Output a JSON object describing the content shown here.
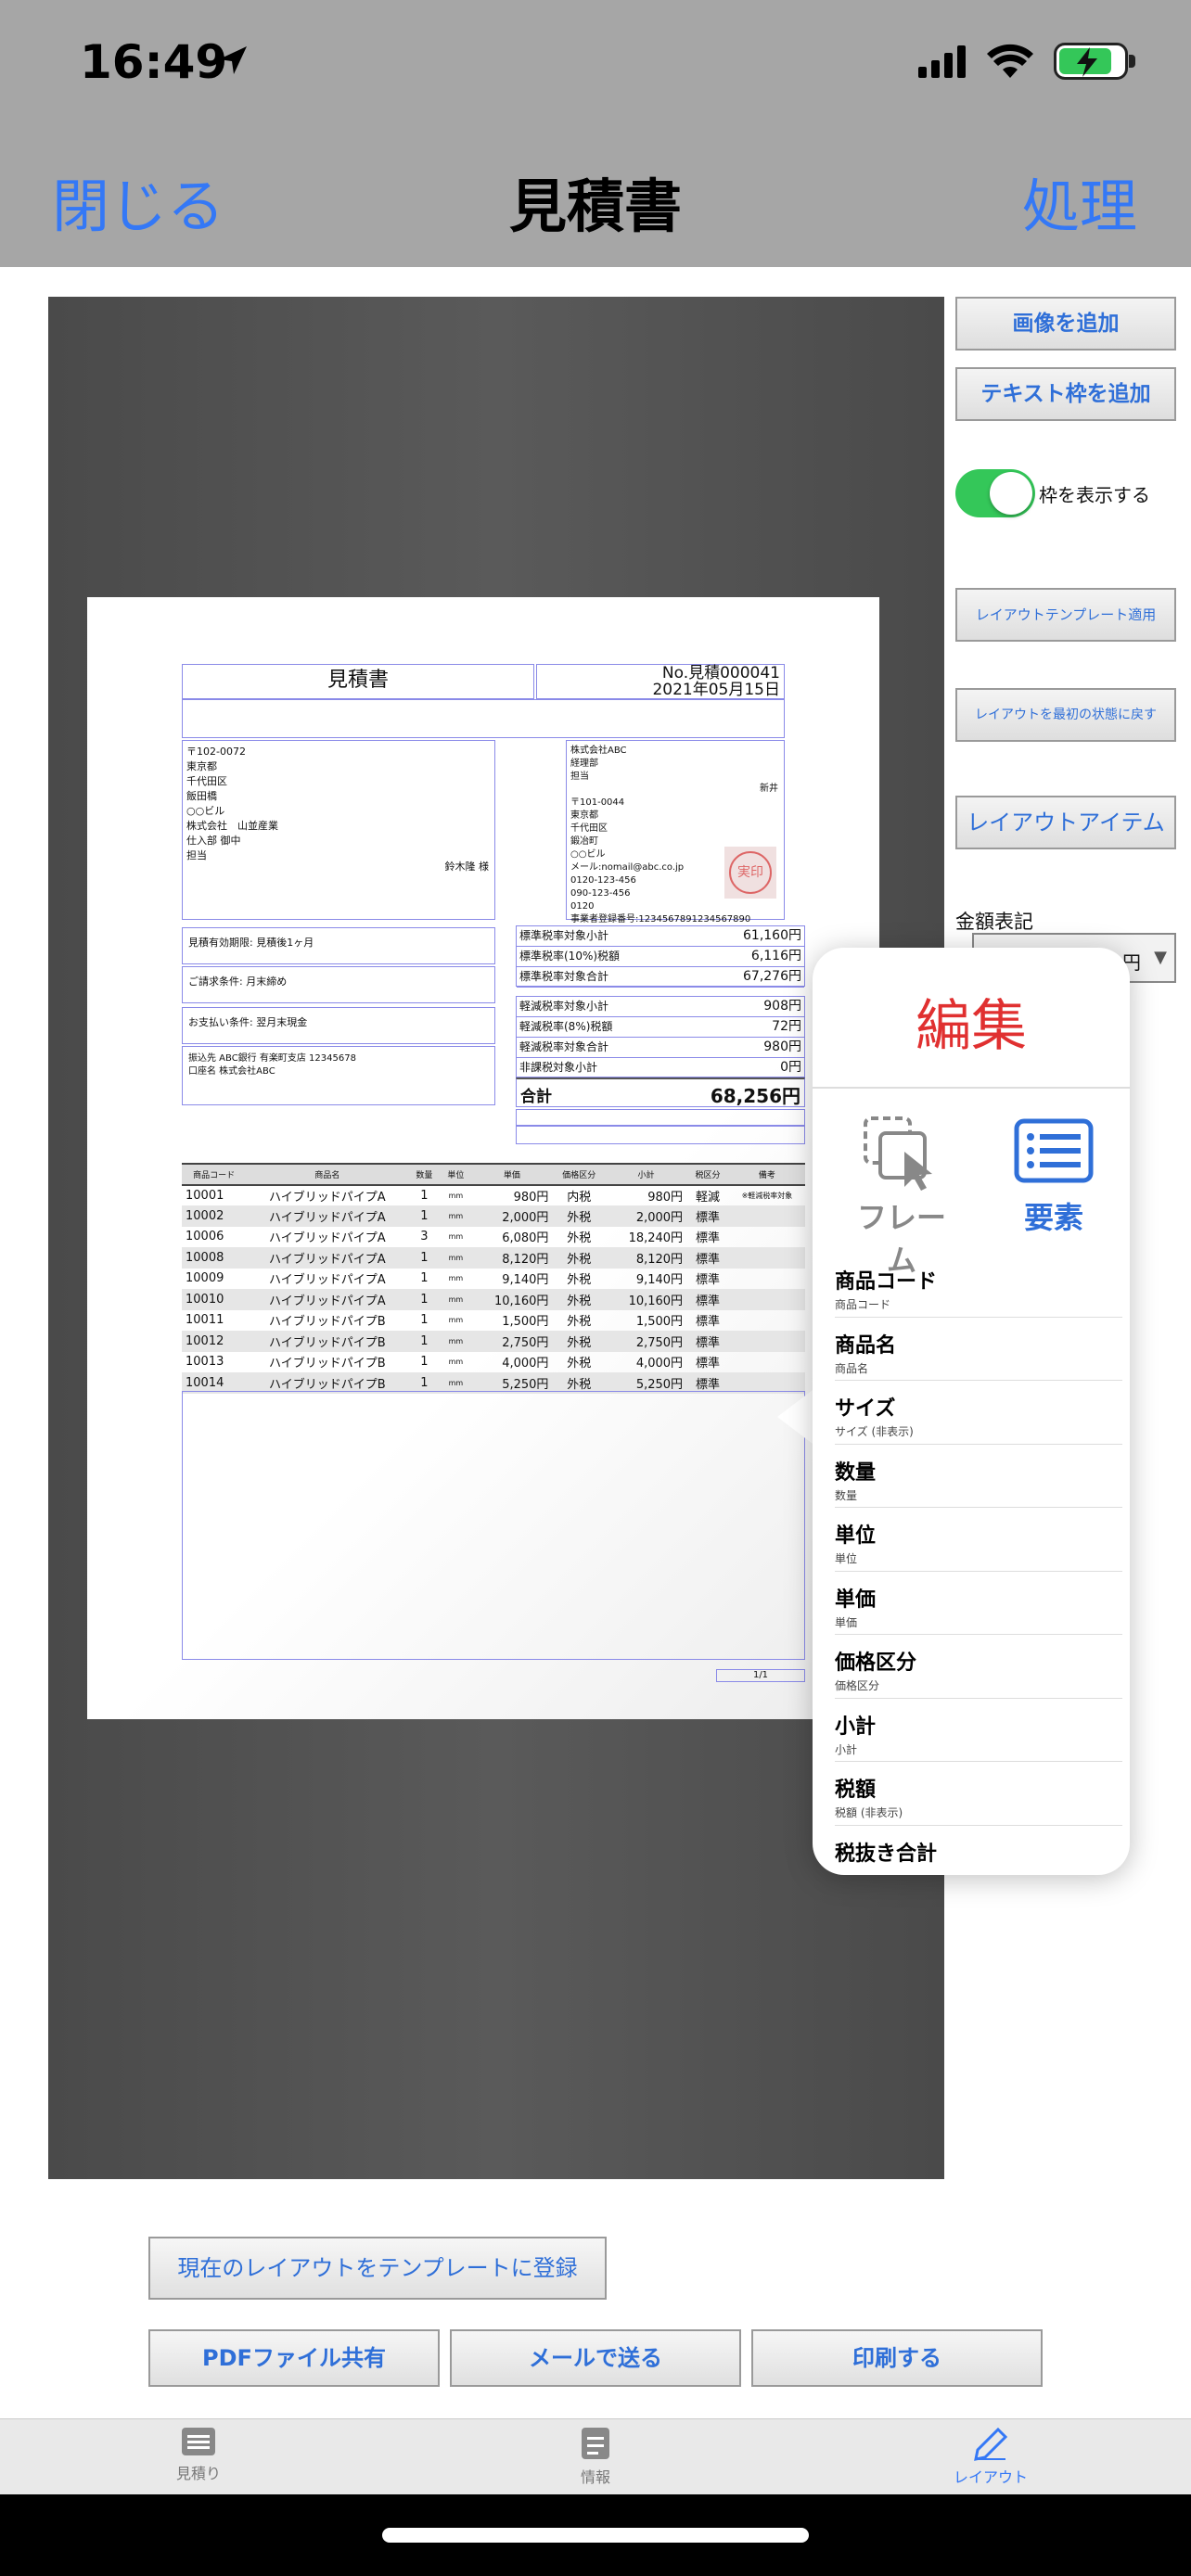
{
  "status": {
    "time": "16:49"
  },
  "nav": {
    "close": "閉じる",
    "title": "見積書",
    "action": "処理"
  },
  "side": {
    "add_image": "画像を追加",
    "add_text": "テキスト枠を追加",
    "show_frame": "枠を表示する",
    "apply_template": "レイアウトテンプレート適用",
    "reset_layout": "レイアウトを最初の状態に戻す",
    "layout_items": "レイアウトアイテム",
    "amount_label": "金額表記",
    "amount_value": "円"
  },
  "doc": {
    "title": "見積書",
    "number": "No.見積000041",
    "date": "2021年05月15日",
    "customer": [
      "〒102-0072",
      "東京都",
      "千代田区",
      "飯田橋",
      "○○ビル",
      "株式会社　山並産業",
      "仕入部 御中",
      "担当"
    ],
    "customer_person": "鈴木隆 様",
    "sender": [
      "株式会社ABC",
      "経理部",
      "担当",
      "",
      "〒101-0044",
      "東京都",
      "千代田区",
      "鍛冶町",
      "○○ビル",
      "メール:nomail@abc.co.jp",
      "0120-123-456",
      "090-123-456",
      "0120",
      "事業者登録番号:1234567891234567890"
    ],
    "sender_staff": "新井",
    "stamp": "実印",
    "validity": "見積有効期限: 見積後1ヶ月",
    "billing": "ご請求条件: 月末締め",
    "payment": "お支払い条件: 翌月末現金",
    "bank": "振込先 ABC銀行 有楽町支店 12345678\n口座名 株式会社ABC",
    "totals1": [
      [
        "標準税率対象小計",
        "61,160円"
      ],
      [
        "標準税率(10%)税額",
        "6,116円"
      ],
      [
        "標準税率対象合計",
        "67,276円"
      ]
    ],
    "totals2": [
      [
        "軽減税率対象小計",
        "908円"
      ],
      [
        "軽減税率(8%)税額",
        "72円"
      ],
      [
        "軽減税率対象合計",
        "980円"
      ],
      [
        "非課税対象小計",
        "0円"
      ]
    ],
    "grand_label": "合計",
    "grand_value": "68,256円",
    "headers": [
      "商品コード",
      "商品名",
      "数量",
      "単位",
      "単価",
      "価格区分",
      "小計",
      "税区分",
      "備考"
    ],
    "rows": [
      [
        "10001",
        "ハイブリッドパイプA",
        "1",
        "mm",
        "980円",
        "内税",
        "980円",
        "軽減",
        "※軽減税率対象"
      ],
      [
        "10002",
        "ハイブリッドパイプA",
        "1",
        "mm",
        "2,000円",
        "外税",
        "2,000円",
        "標準",
        ""
      ],
      [
        "10006",
        "ハイブリッドパイプA",
        "3",
        "mm",
        "6,080円",
        "外税",
        "18,240円",
        "標準",
        ""
      ],
      [
        "10008",
        "ハイブリッドパイプA",
        "1",
        "mm",
        "8,120円",
        "外税",
        "8,120円",
        "標準",
        ""
      ],
      [
        "10009",
        "ハイブリッドパイプA",
        "1",
        "mm",
        "9,140円",
        "外税",
        "9,140円",
        "標準",
        ""
      ],
      [
        "10010",
        "ハイブリッドパイプA",
        "1",
        "mm",
        "10,160円",
        "外税",
        "10,160円",
        "標準",
        ""
      ],
      [
        "10011",
        "ハイブリッドパイプB",
        "1",
        "mm",
        "1,500円",
        "外税",
        "1,500円",
        "標準",
        ""
      ],
      [
        "10012",
        "ハイブリッドパイプB",
        "1",
        "mm",
        "2,750円",
        "外税",
        "2,750円",
        "標準",
        ""
      ],
      [
        "10013",
        "ハイブリッドパイプB",
        "1",
        "mm",
        "4,000円",
        "外税",
        "4,000円",
        "標準",
        ""
      ],
      [
        "10014",
        "ハイブリッドパイプB",
        "1",
        "mm",
        "5,250円",
        "外税",
        "5,250円",
        "標準",
        ""
      ]
    ],
    "page": "1/1"
  },
  "popover": {
    "title": "編集",
    "tab_frame": "フレーム",
    "tab_element": "要素",
    "items": [
      [
        "商品コード",
        "商品コード"
      ],
      [
        "商品名",
        "商品名"
      ],
      [
        "サイズ",
        "サイズ (非表示)"
      ],
      [
        "数量",
        "数量"
      ],
      [
        "単位",
        "単位"
      ],
      [
        "単価",
        "単価"
      ],
      [
        "価格区分",
        "価格区分"
      ],
      [
        "小計",
        "小計"
      ],
      [
        "税額",
        "税額 (非表示)"
      ],
      [
        "税抜き合計",
        ""
      ]
    ]
  },
  "bottom": {
    "register_template": "現在のレイアウトをテンプレートに登録",
    "share_pdf": "PDFファイル共有",
    "send_mail": "メールで送る",
    "print": "印刷する"
  },
  "tabs": [
    {
      "label": "見積り"
    },
    {
      "label": "情報"
    },
    {
      "label": "レイアウト"
    }
  ],
  "colors": {
    "accent": "#3478f6",
    "edit_red": "#e03030",
    "toggle_green": "#34c759"
  }
}
